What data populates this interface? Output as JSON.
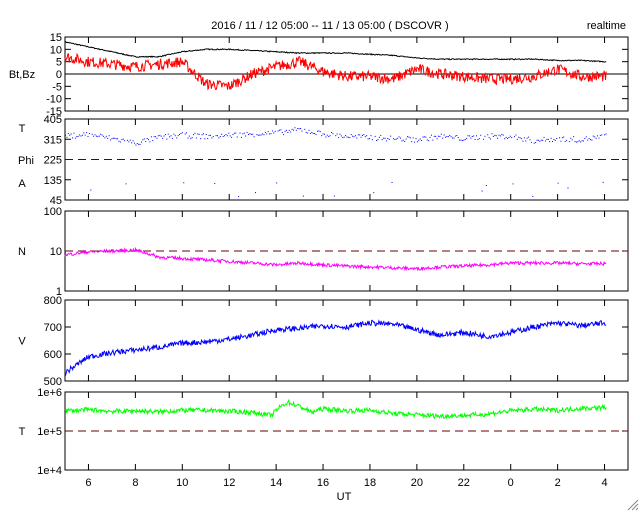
{
  "header": {
    "title": "2016 / 11 / 12   05:00 -- 11 / 13   05:00 ( DSCOVR )",
    "mode": "realtime"
  },
  "chart_data": [
    {
      "type": "line",
      "id": "mag",
      "ylabel": "Bt,Bz",
      "ylim": [
        -15,
        15
      ],
      "scale": "linear",
      "ticks": [
        "15",
        "10",
        "5",
        "0",
        "-5",
        "-10",
        "-15"
      ],
      "tick_values": [
        15,
        10,
        5,
        0,
        -5,
        -10,
        -15
      ],
      "refline": 0,
      "refline_style": "solid",
      "hours_from_start": [
        0,
        1,
        2,
        3,
        4,
        5,
        6,
        7,
        8,
        9,
        10,
        11,
        12,
        13,
        14,
        15,
        16,
        17,
        18,
        19,
        20,
        21,
        22,
        23
      ],
      "series": [
        {
          "name": "Bt",
          "color": "#000000",
          "values": [
            13,
            11,
            9,
            7,
            7,
            9,
            10,
            10,
            9.5,
            9,
            8.5,
            8.5,
            8.5,
            8,
            7.5,
            6.5,
            6,
            6,
            6,
            6,
            6,
            5.5,
            5.5,
            5
          ]
        },
        {
          "name": "Bz",
          "color": "#ff0000",
          "values": [
            7,
            5,
            4,
            3,
            4,
            5,
            -4,
            -5,
            0,
            3,
            5,
            1,
            -1,
            -1,
            -2,
            2,
            0,
            -1,
            -2,
            -2,
            -1,
            2,
            -1,
            -1
          ]
        }
      ]
    },
    {
      "type": "scatter",
      "id": "angle",
      "ylabel_lines": [
        "T",
        "Phi",
        "A"
      ],
      "ylim": [
        45,
        405
      ],
      "scale": "linear",
      "ticks": [
        "405",
        "315",
        "225",
        "135",
        "45"
      ],
      "tick_values": [
        405,
        315,
        225,
        135,
        45
      ],
      "refline": 225,
      "refline_style": "dashed",
      "hours_from_start": [
        0,
        1,
        2,
        3,
        4,
        5,
        6,
        7,
        8,
        9,
        10,
        11,
        12,
        13,
        14,
        15,
        16,
        17,
        18,
        19,
        20,
        21,
        22,
        23
      ],
      "series": [
        {
          "name": "Phi",
          "color": "#0000ff",
          "values": [
            330,
            340,
            320,
            300,
            325,
            335,
            330,
            335,
            340,
            345,
            360,
            340,
            330,
            325,
            320,
            315,
            330,
            320,
            330,
            330,
            310,
            320,
            315,
            330
          ]
        }
      ]
    },
    {
      "type": "line",
      "id": "density",
      "ylabel": "N",
      "ylim": [
        1,
        100
      ],
      "scale": "log",
      "ticks": [
        "100",
        "10",
        "1"
      ],
      "tick_values": [
        100,
        10,
        1
      ],
      "refline": 10,
      "refline_style": "dashed",
      "hours_from_start": [
        0,
        1,
        2,
        3,
        4,
        5,
        6,
        7,
        8,
        9,
        10,
        11,
        12,
        13,
        14,
        15,
        16,
        17,
        18,
        19,
        20,
        21,
        22,
        23
      ],
      "series": [
        {
          "name": "N",
          "color": "#ff00ff",
          "values": [
            8,
            9.5,
            10,
            10.5,
            7,
            6.5,
            6,
            5.5,
            5,
            4.5,
            5,
            4.5,
            4.2,
            4,
            3.8,
            3.6,
            4,
            4.2,
            4.5,
            5,
            5,
            5,
            4.8,
            4.8
          ]
        }
      ]
    },
    {
      "type": "line",
      "id": "speed",
      "ylabel": "V",
      "ylim": [
        500,
        800
      ],
      "scale": "linear",
      "ticks": [
        "800",
        "700",
        "600",
        "500"
      ],
      "tick_values": [
        800,
        700,
        600,
        500
      ],
      "hours_from_start": [
        0,
        1,
        2,
        3,
        4,
        5,
        6,
        7,
        8,
        9,
        10,
        11,
        12,
        13,
        14,
        15,
        16,
        17,
        18,
        19,
        20,
        21,
        22,
        23
      ],
      "series": [
        {
          "name": "V",
          "color": "#0000ff",
          "values": [
            530,
            590,
            605,
            615,
            625,
            640,
            645,
            655,
            670,
            690,
            695,
            705,
            700,
            715,
            710,
            690,
            670,
            680,
            665,
            680,
            700,
            715,
            705,
            715
          ]
        }
      ]
    },
    {
      "type": "line",
      "id": "temperature",
      "ylabel": "T",
      "ylim": [
        10000,
        1000000
      ],
      "scale": "log",
      "ticks": [
        "1e+6",
        "1e+5",
        "1e+4"
      ],
      "tick_values": [
        1000000,
        100000,
        10000
      ],
      "refline": 100000,
      "refline_style": "dashed",
      "hours_from_start": [
        0,
        1,
        2,
        3,
        4,
        5,
        6,
        7,
        8,
        8.8,
        9.5,
        10.5,
        11,
        12,
        13,
        14,
        15,
        16,
        17,
        18,
        19,
        20,
        21,
        22,
        23
      ],
      "series": [
        {
          "name": "T",
          "color": "#00ff00",
          "values": [
            330000,
            350000,
            320000,
            330000,
            310000,
            340000,
            340000,
            320000,
            300000,
            250000,
            550000,
            300000,
            370000,
            330000,
            340000,
            280000,
            260000,
            240000,
            250000,
            270000,
            330000,
            360000,
            340000,
            380000,
            400000
          ]
        }
      ]
    }
  ],
  "xaxis": {
    "label": "UT",
    "ticks": [
      "6",
      "8",
      "10",
      "12",
      "14",
      "16",
      "18",
      "20",
      "22",
      "0",
      "2",
      "4"
    ],
    "tick_hours_from_start": [
      1,
      3,
      5,
      7,
      9,
      11,
      13,
      15,
      17,
      19,
      21,
      23
    ],
    "range_hours": [
      0,
      24
    ]
  }
}
